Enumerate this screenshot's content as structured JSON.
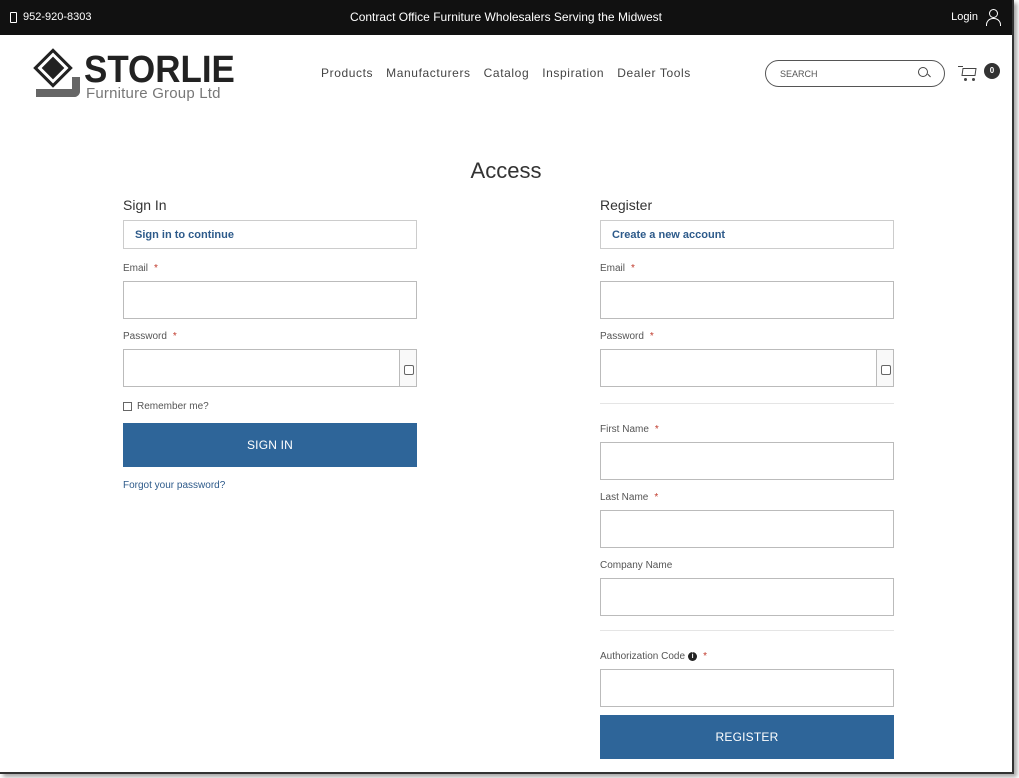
{
  "topbar": {
    "phone": "952-920-8303",
    "tagline": "Contract Office Furniture Wholesalers Serving the Midwest",
    "login_label": "Login"
  },
  "header": {
    "logo_title": "STORLIE",
    "logo_subtitle": "Furniture Group Ltd",
    "nav": {
      "products": "Products",
      "manufacturers": "Manufacturers",
      "catalog": "Catalog",
      "inspiration": "Inspiration",
      "dealer_tools": "Dealer Tools"
    },
    "search_placeholder": "SEARCH",
    "cart_count": "0"
  },
  "main": {
    "title": "Access",
    "signin": {
      "title": "Sign In",
      "subhead": "Sign in to continue",
      "email_label": "Email",
      "password_label": "Password",
      "required_mark": "*",
      "remember_label": "Remember me?",
      "button_label": "SIGN IN",
      "forgot_label": "Forgot your password?"
    },
    "register": {
      "title": "Register",
      "subhead": "Create a new account",
      "email_label": "Email",
      "password_label": "Password",
      "first_name_label": "First Name",
      "last_name_label": "Last Name",
      "company_label": "Company Name",
      "auth_code_label": "Authorization Code",
      "required_mark": "*",
      "info_glyph": "i",
      "button_label": "REGISTER"
    }
  },
  "colors": {
    "topbar_bg": "#111111",
    "button_bg": "#2e6599",
    "link": "#2d5a8a",
    "required": "#c0392b"
  }
}
